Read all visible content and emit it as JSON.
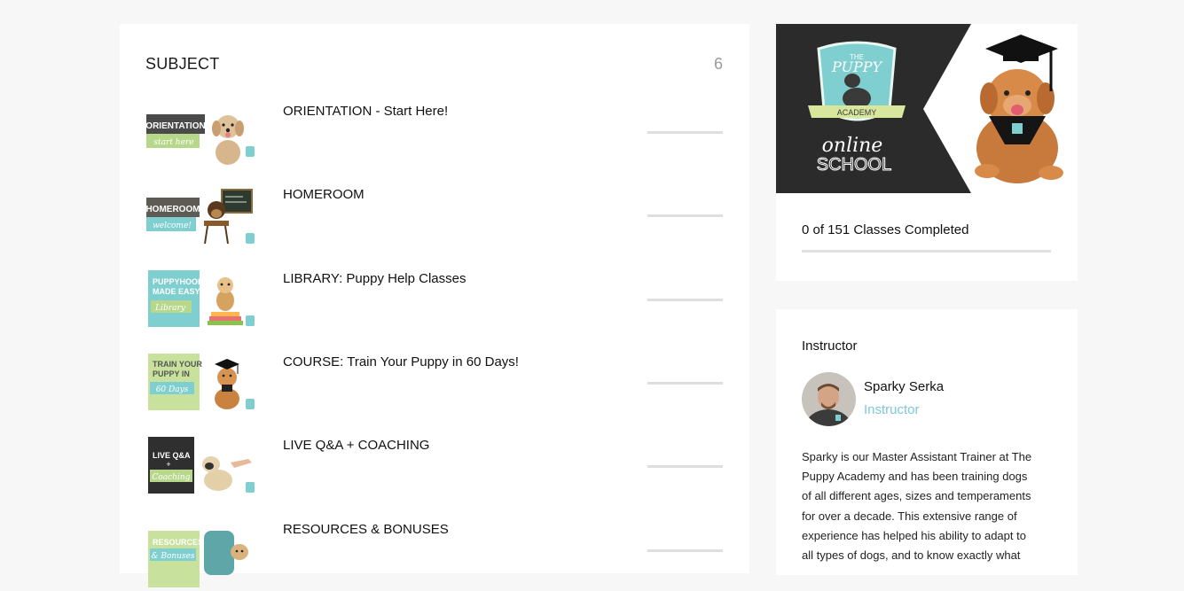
{
  "subjects": {
    "title": "SUBJECT",
    "count": "6",
    "items": [
      {
        "label": "ORIENTATION - Start Here!",
        "thumb_line1": "ORIENTATION",
        "thumb_line2": "start here"
      },
      {
        "label": "HOMEROOM",
        "thumb_line1": "HOMEROOM",
        "thumb_line2": "welcome!"
      },
      {
        "label": "LIBRARY: Puppy Help Classes",
        "thumb_line1": "PUPPYHOOD",
        "thumb_line2": "MADE EASY",
        "thumb_line3": "Library"
      },
      {
        "label": "COURSE: Train Your Puppy in 60 Days!",
        "thumb_line1": "TRAIN YOUR",
        "thumb_line2": "PUPPY IN",
        "thumb_line3": "60 Days"
      },
      {
        "label": "LIVE Q&A + COACHING",
        "thumb_line1": "LIVE Q&A",
        "thumb_line2": "+",
        "thumb_line3": "Coaching"
      },
      {
        "label": "RESOURCES & BONUSES",
        "thumb_line1": "RESOURCES",
        "thumb_line2": "& Bonuses"
      }
    ]
  },
  "course": {
    "banner": {
      "the": "THE",
      "puppy": "PUPPY",
      "academy": "ACADEMY",
      "online": "online",
      "school": "SCHOOL"
    },
    "progress_text": "0 of 151 Classes Completed",
    "progress_fraction": 0
  },
  "instructor": {
    "heading": "Instructor",
    "name": "Sparky Serka",
    "role": "Instructor",
    "bio_lines": [
      "Sparky is our Master Assistant Trainer at The",
      "Puppy Academy and has been training dogs",
      "of all different ages, sizes and temperaments",
      "for over a decade. This extensive range of",
      "experience has helped his ability to adapt to",
      "all types of dogs, and to know exactly what"
    ]
  },
  "colors": {
    "page_bg": "#f7f7f7",
    "card_bg": "#ffffff",
    "accent_teal": "#7ec8d6",
    "chalkboard": "#2b2b2b",
    "label_dark": "#4a4a4a",
    "label_green": "#b7d88b",
    "label_teal": "#7fcfd1"
  }
}
